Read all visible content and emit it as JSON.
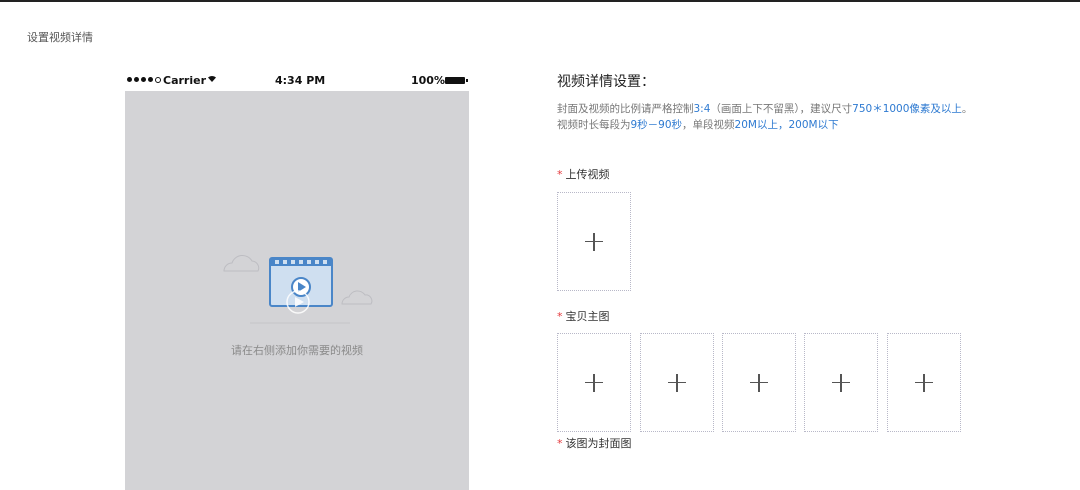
{
  "page": {
    "title": "设置视频详情"
  },
  "phone": {
    "carrier": "Carrier",
    "wifi_icon": "wifi-icon",
    "time": "4:34 PM",
    "battery": "100%",
    "empty_state_text": "请在右侧添加你需要的视频"
  },
  "settings": {
    "title": "视频详情设置：",
    "desc": {
      "p1": "封面及视频的比例请严格控制",
      "ratio": "3:4",
      "p2": "（画面上下不留黑），建议尺寸",
      "size": "750＊1000像素及以上",
      "p3": "。视频时长每段为",
      "duration": "9秒－90秒",
      "p4": "，单段视频",
      "filesize": "20M以上，200M以下"
    },
    "upload_video_label": "上传视频",
    "main_image_label": "宝贝主图",
    "cover_note": "该图为封面图",
    "required_mark": "*"
  },
  "colors": {
    "highlight": "#2e7ad1",
    "required": "#e4393c",
    "phone_bg": "#d3d3d6",
    "icon_blue": "#4a86c8"
  }
}
